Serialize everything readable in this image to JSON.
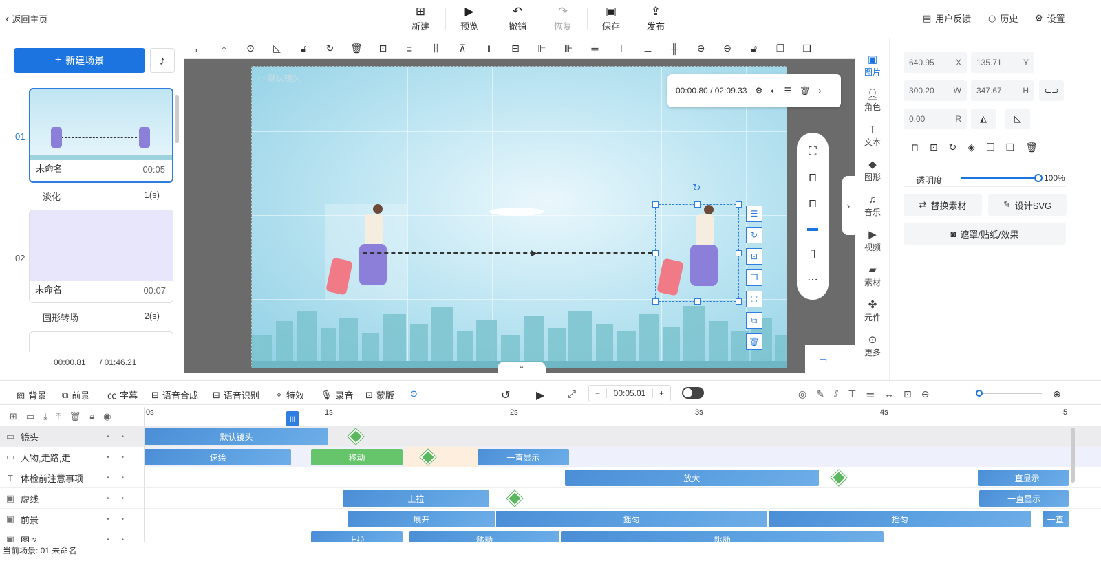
{
  "topbar": {
    "back": "返回主页",
    "new": "新建",
    "preview": "预览",
    "undo": "撤销",
    "redo": "恢复",
    "save": "保存",
    "publish": "发布",
    "feedback": "用户反馈",
    "history": "历史",
    "settings": "设置"
  },
  "left": {
    "new_scene": "新建场景",
    "scenes": [
      {
        "num": "01",
        "name": "未命名",
        "dur": "00:05",
        "trans": "淡化",
        "trans_dur": "1(s)"
      },
      {
        "num": "02",
        "name": "未命名",
        "dur": "00:07",
        "trans": "圆形转场",
        "trans_dur": "2(s)"
      }
    ],
    "time_current": "00:00.81",
    "time_total": "/ 01:46.21"
  },
  "canvas": {
    "camera_label": "默认镜头",
    "player_time": "00:00.80",
    "player_sep": "/",
    "player_total": "02:09.33"
  },
  "right_icons": [
    {
      "label": "图片",
      "icon": "image-icon"
    },
    {
      "label": "角色",
      "icon": "role-icon"
    },
    {
      "label": "文本",
      "icon": "text-icon"
    },
    {
      "label": "图形",
      "icon": "shape-icon"
    },
    {
      "label": "音乐",
      "icon": "music-icon"
    },
    {
      "label": "视频",
      "icon": "video-icon"
    },
    {
      "label": "素材",
      "icon": "material-icon"
    },
    {
      "label": "元件",
      "icon": "widget-icon"
    },
    {
      "label": "更多",
      "icon": "more-icon"
    }
  ],
  "props": {
    "x": "640.95",
    "x_label": "X",
    "y": "135.71",
    "y_label": "Y",
    "w": "300.20",
    "w_label": "W",
    "h": "347.67",
    "h_label": "H",
    "r": "0.00",
    "r_label": "R",
    "opacity_label": "透明度",
    "opacity_value": "100%",
    "opacity_fraction": 1.0,
    "replace": "替换素材",
    "design_svg": "设计SVG",
    "mask": "遮罩/贴纸/效果"
  },
  "timeline_toolbar": {
    "bg": "背景",
    "fg": "前景",
    "subtitle": "字幕",
    "tts": "语音合成",
    "asr": "语音识别",
    "effects": "特效",
    "record": "录音",
    "mask": "蒙版",
    "time": "00:05.01",
    "minus": "−",
    "plus": "+"
  },
  "ruler": [
    "0s",
    "1s",
    "2s",
    "3s",
    "4s",
    "5"
  ],
  "tracks": [
    {
      "name": "镜头",
      "clips": [
        {
          "label": "默认镜头",
          "start": 0,
          "end": 1.0
        }
      ],
      "keyframes": [
        1.14
      ]
    },
    {
      "name": "人物,走路,走",
      "clips": [
        {
          "label": "速绘",
          "start": 0,
          "end": 0.8
        },
        {
          "label": "移动",
          "start": 0.9,
          "end": 1.4,
          "green": true
        },
        {
          "label": "一直显示",
          "start": 1.8,
          "end": 2.3
        }
      ],
      "keyframes": [
        1.53
      ]
    },
    {
      "name": "体检前注意事项",
      "clips": [
        {
          "label": "放大",
          "start": 2.27,
          "end": 3.65
        },
        {
          "label": "一直显示",
          "start": 4.5,
          "end": 5.0
        }
      ],
      "keyframes": [
        3.75
      ]
    },
    {
      "name": "虚线",
      "clips": [
        {
          "label": "上拉",
          "start": 1.07,
          "end": 1.87
        },
        {
          "label": "一直显示",
          "start": 4.51,
          "end": 5.0
        }
      ],
      "keyframes": [
        2.0
      ]
    },
    {
      "name": "前景",
      "clips": [
        {
          "label": "展开",
          "start": 1.1,
          "end": 1.9
        },
        {
          "label": "摇匀",
          "start": 1.9,
          "end": 3.37
        },
        {
          "label": "摇匀",
          "start": 3.37,
          "end": 4.8
        },
        {
          "label": "一直",
          "start": 4.85,
          "end": 5.0
        }
      ],
      "keyframes": []
    },
    {
      "name": "图 2",
      "clips": [
        {
          "label": "上拉",
          "start": 0.9,
          "end": 1.4
        },
        {
          "label": "移动",
          "start": 1.43,
          "end": 2.25
        },
        {
          "label": "跳动",
          "start": 2.25,
          "end": 4.0
        }
      ],
      "keyframes": []
    }
  ],
  "status": {
    "text": "当前场景: 01   未命名"
  }
}
